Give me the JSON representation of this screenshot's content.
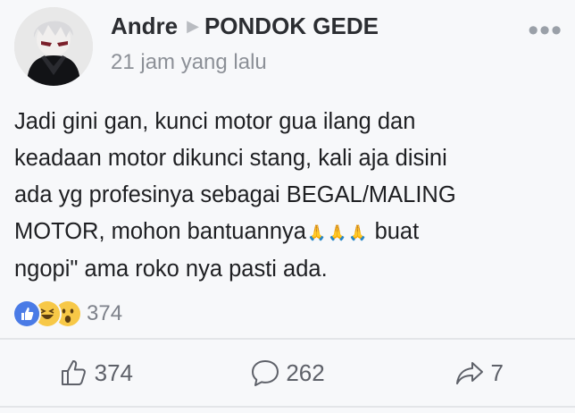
{
  "post": {
    "author": "Andre",
    "group": "PONDOK GEDE",
    "timestamp": "21 jam yang lalu",
    "body": {
      "line1": "Jadi gini gan, kunci motor gua ilang dan",
      "line2": "keadaan motor dikunci stang, kali aja disini",
      "line3": "ada yg profesinya sebagai BEGAL/MALING",
      "line4_pre": "MOTOR, mohon bantuannya",
      "line4_post": " buat",
      "line5": "ngopi\" ama roko nya pasti ada."
    },
    "emoji": "🙏",
    "reaction_icons": [
      "like-icon",
      "haha-icon",
      "wow-icon"
    ],
    "reaction_count": "374"
  },
  "actions": {
    "like_count": "374",
    "comment_count": "262",
    "share_count": "7"
  },
  "colors": {
    "like_blue": "#4267b2",
    "reaction_yellow": "#f7c847",
    "text": "#1c1e21",
    "muted": "#8c9097"
  }
}
